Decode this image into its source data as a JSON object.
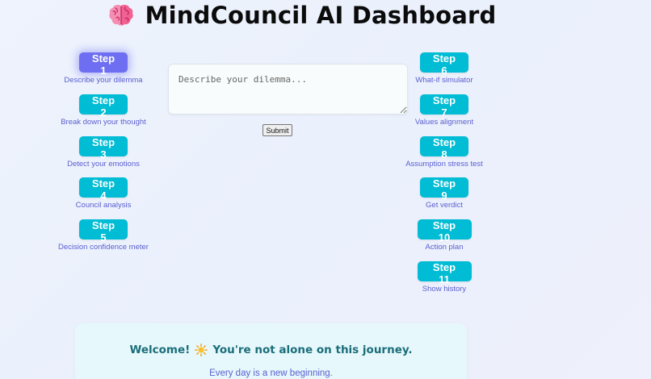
{
  "header": {
    "title": "MindCouncil AI Dashboard",
    "icon": "brain-icon"
  },
  "steps_left": [
    {
      "label": "Step 1",
      "caption": "Describe your dilemma",
      "active": true
    },
    {
      "label": "Step 2",
      "caption": "Break down your thought",
      "active": false
    },
    {
      "label": "Step 3",
      "caption": "Detect your emotions",
      "active": false
    },
    {
      "label": "Step 4",
      "caption": "Council analysis",
      "active": false
    },
    {
      "label": "Step 5",
      "caption": "Decision confidence meter",
      "active": false
    }
  ],
  "steps_right": [
    {
      "label": "Step 6",
      "caption": "What-if simulator"
    },
    {
      "label": "Step 7",
      "caption": "Values alignment"
    },
    {
      "label": "Step 8",
      "caption": "Assumption stress test"
    },
    {
      "label": "Step 9",
      "caption": "Get verdict"
    },
    {
      "label": "Step 10",
      "caption": "Action plan"
    },
    {
      "label": "Step 11",
      "caption": "Show history"
    }
  ],
  "input": {
    "placeholder": "Describe your dilemma...",
    "value": ""
  },
  "submit_label": "Submit",
  "welcome": {
    "title_prefix": "Welcome!",
    "title_suffix": "You're not alone on this journey.",
    "icon": "sun-icon",
    "subtitle": "Every day is a new beginning."
  },
  "colors": {
    "step_button": "#00bcd4",
    "step_button_active": "#6e6ef2",
    "caption": "#5a5fcf",
    "welcome_title": "#1a6d7a",
    "welcome_card": "#e6f8fb"
  }
}
